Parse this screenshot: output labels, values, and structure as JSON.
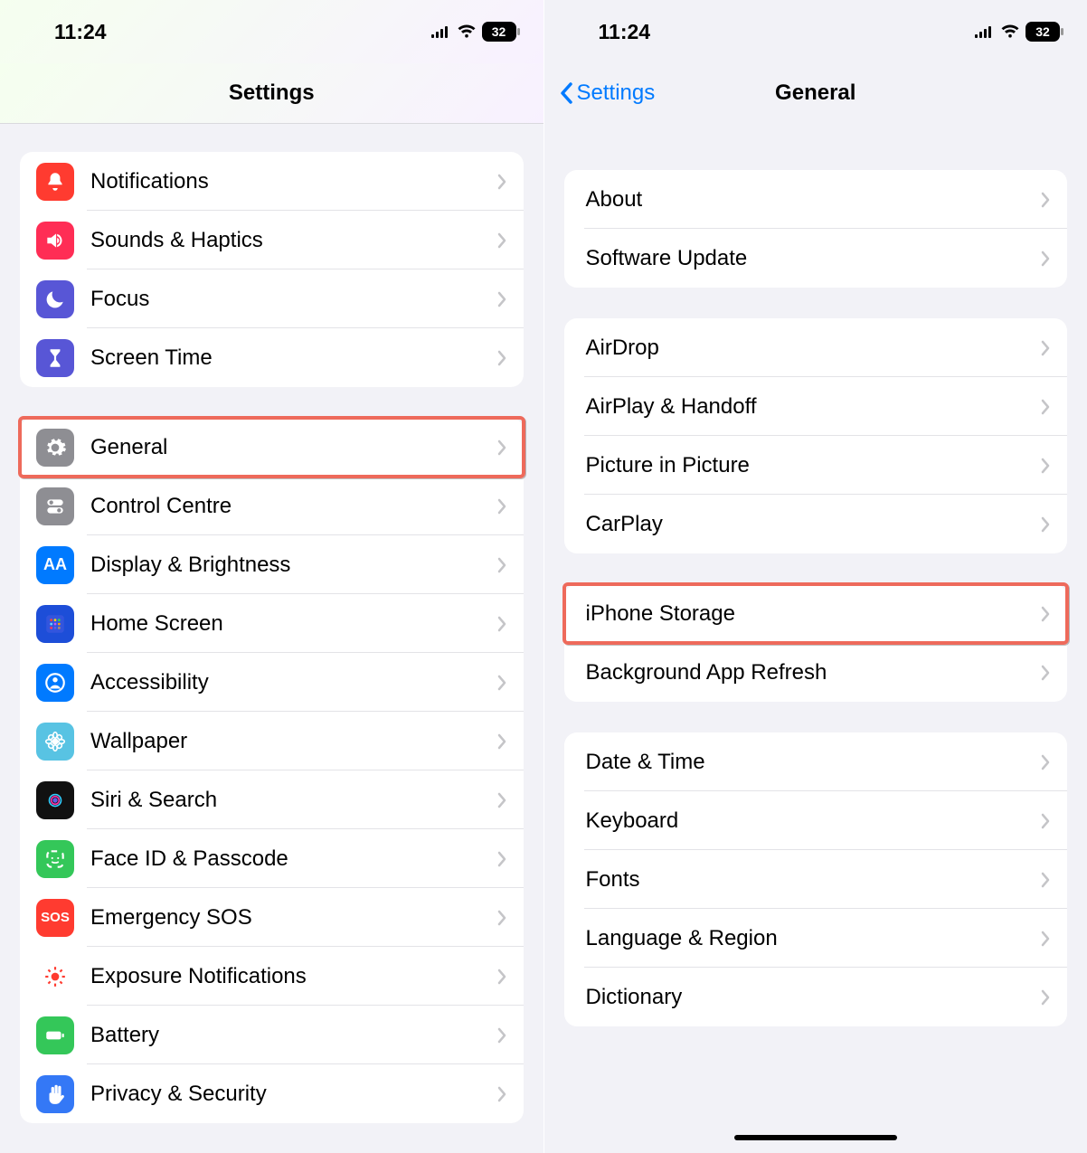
{
  "status": {
    "time": "11:24",
    "battery": "32"
  },
  "left": {
    "title": "Settings",
    "highlightIndex": 4,
    "groups": [
      [
        {
          "id": "notifications",
          "label": "Notifications",
          "iconColor": "c-red",
          "icon": "bell"
        },
        {
          "id": "sounds",
          "label": "Sounds & Haptics",
          "iconColor": "c-pink",
          "icon": "speaker"
        },
        {
          "id": "focus",
          "label": "Focus",
          "iconColor": "c-indigo",
          "icon": "moon"
        },
        {
          "id": "screen-time",
          "label": "Screen Time",
          "iconColor": "c-indigo",
          "icon": "hourglass"
        }
      ],
      [
        {
          "id": "general",
          "label": "General",
          "iconColor": "c-gray",
          "icon": "gear"
        },
        {
          "id": "control-centre",
          "label": "Control Centre",
          "iconColor": "c-gray",
          "icon": "switches"
        },
        {
          "id": "display",
          "label": "Display & Brightness",
          "iconColor": "c-blue",
          "icon": "aa"
        },
        {
          "id": "home-screen",
          "label": "Home Screen",
          "iconColor": "c-darkblue",
          "icon": "grid"
        },
        {
          "id": "accessibility",
          "label": "Accessibility",
          "iconColor": "c-blue",
          "icon": "person"
        },
        {
          "id": "wallpaper",
          "label": "Wallpaper",
          "iconColor": "c-teal",
          "icon": "flower"
        },
        {
          "id": "siri",
          "label": "Siri & Search",
          "iconColor": "c-siri",
          "icon": "siri"
        },
        {
          "id": "faceid",
          "label": "Face ID & Passcode",
          "iconColor": "c-green",
          "icon": "face"
        },
        {
          "id": "sos",
          "label": "Emergency SOS",
          "iconColor": "c-sos",
          "icon": "sos"
        },
        {
          "id": "exposure",
          "label": "Exposure Notifications",
          "iconColor": "c-exposure",
          "icon": "exposure"
        },
        {
          "id": "battery",
          "label": "Battery",
          "iconColor": "c-green",
          "icon": "battery"
        },
        {
          "id": "privacy",
          "label": "Privacy & Security",
          "iconColor": "c-hand",
          "icon": "hand"
        }
      ]
    ]
  },
  "right": {
    "backLabel": "Settings",
    "title": "General",
    "highlightIndex": 6,
    "groups": [
      [
        {
          "id": "about",
          "label": "About"
        },
        {
          "id": "software-update",
          "label": "Software Update"
        }
      ],
      [
        {
          "id": "airdrop",
          "label": "AirDrop"
        },
        {
          "id": "airplay",
          "label": "AirPlay & Handoff"
        },
        {
          "id": "pip",
          "label": "Picture in Picture"
        },
        {
          "id": "carplay",
          "label": "CarPlay"
        }
      ],
      [
        {
          "id": "iphone-storage",
          "label": "iPhone Storage"
        },
        {
          "id": "bg-refresh",
          "label": "Background App Refresh"
        }
      ],
      [
        {
          "id": "date-time",
          "label": "Date & Time"
        },
        {
          "id": "keyboard",
          "label": "Keyboard"
        },
        {
          "id": "fonts",
          "label": "Fonts"
        },
        {
          "id": "lang-region",
          "label": "Language & Region"
        },
        {
          "id": "dictionary",
          "label": "Dictionary"
        }
      ]
    ]
  }
}
